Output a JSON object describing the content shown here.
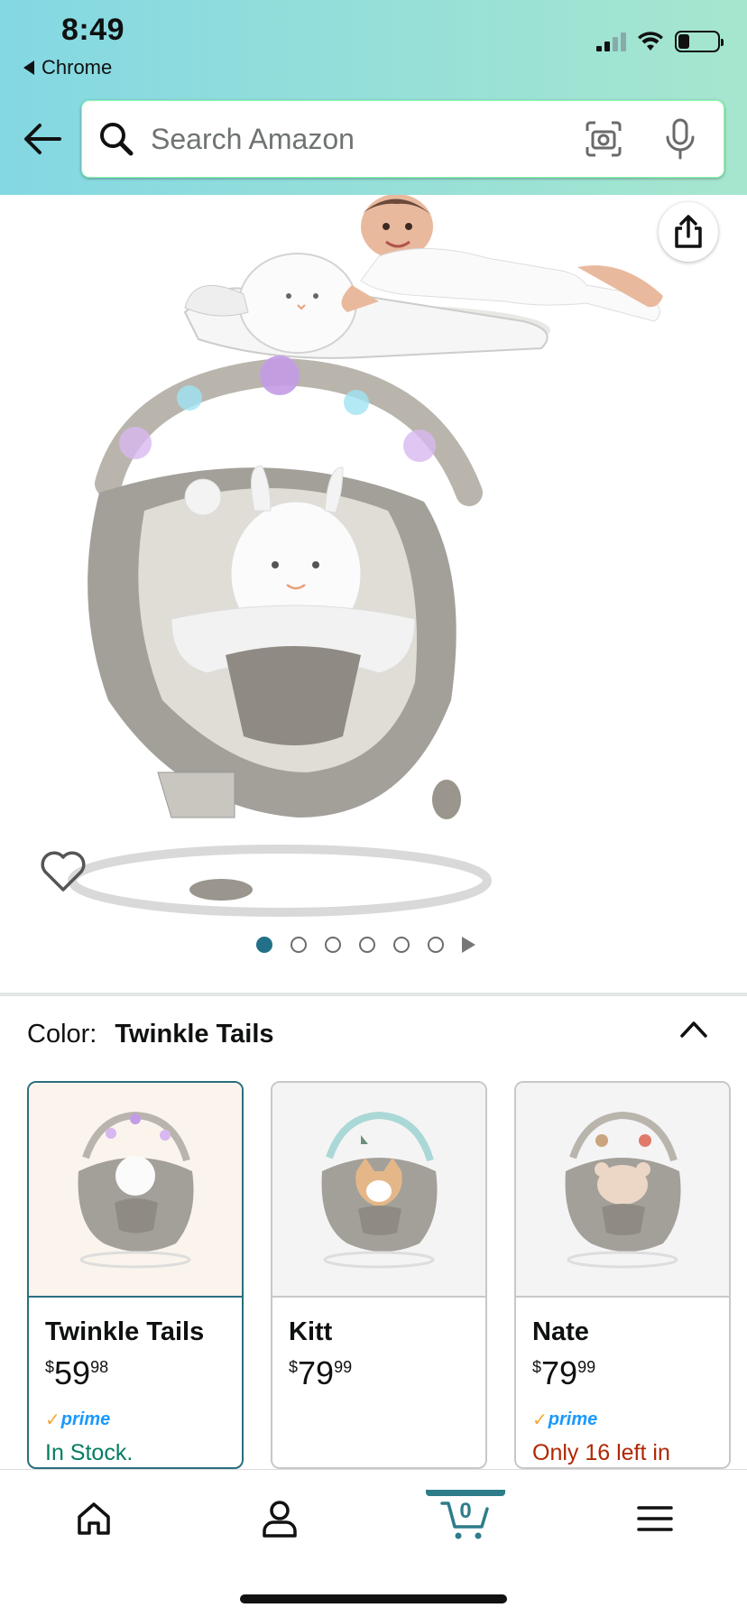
{
  "status_bar": {
    "time": "8:49",
    "back_app": "Chrome",
    "signal_icon": "cellular-signal-icon",
    "wifi_icon": "wifi-icon",
    "battery_icon": "battery-icon"
  },
  "header": {
    "back_icon": "back-arrow-icon",
    "search": {
      "placeholder": "Search Amazon",
      "value": ""
    },
    "camera_icon": "camera-icon",
    "mic_icon": "microphone-icon",
    "background_colors": [
      "#84d8e3",
      "#a6e6ce"
    ]
  },
  "gallery": {
    "share_icon": "share-icon",
    "wishlist_icon": "heart-icon",
    "image_count": 6,
    "active_index": 0,
    "next_icon": "play-next-icon",
    "active_dot_color": "#227188"
  },
  "variations": {
    "label": "Color:",
    "selected": "Twinkle Tails",
    "collapse_icon": "chevron-up-icon",
    "options": [
      {
        "name": "Twinkle Tails",
        "currency": "$",
        "dollars": "59",
        "cents": "98",
        "prime": "prime",
        "stock": "In Stock.",
        "stock_color": "#067d62",
        "selected": true
      },
      {
        "name": "Kitt",
        "currency": "$",
        "dollars": "79",
        "cents": "99",
        "prime": "",
        "stock": "",
        "selected": false
      },
      {
        "name": "Nate",
        "currency": "$",
        "dollars": "79",
        "cents": "99",
        "prime": "prime",
        "stock": "Only 16 left in",
        "stock_color": "#b12704",
        "selected": false
      }
    ]
  },
  "bottom_nav": {
    "items": [
      "home-icon",
      "account-icon",
      "cart-icon",
      "menu-icon"
    ],
    "cart_count": "0",
    "active": "cart",
    "accent": "#2e7c8a"
  }
}
